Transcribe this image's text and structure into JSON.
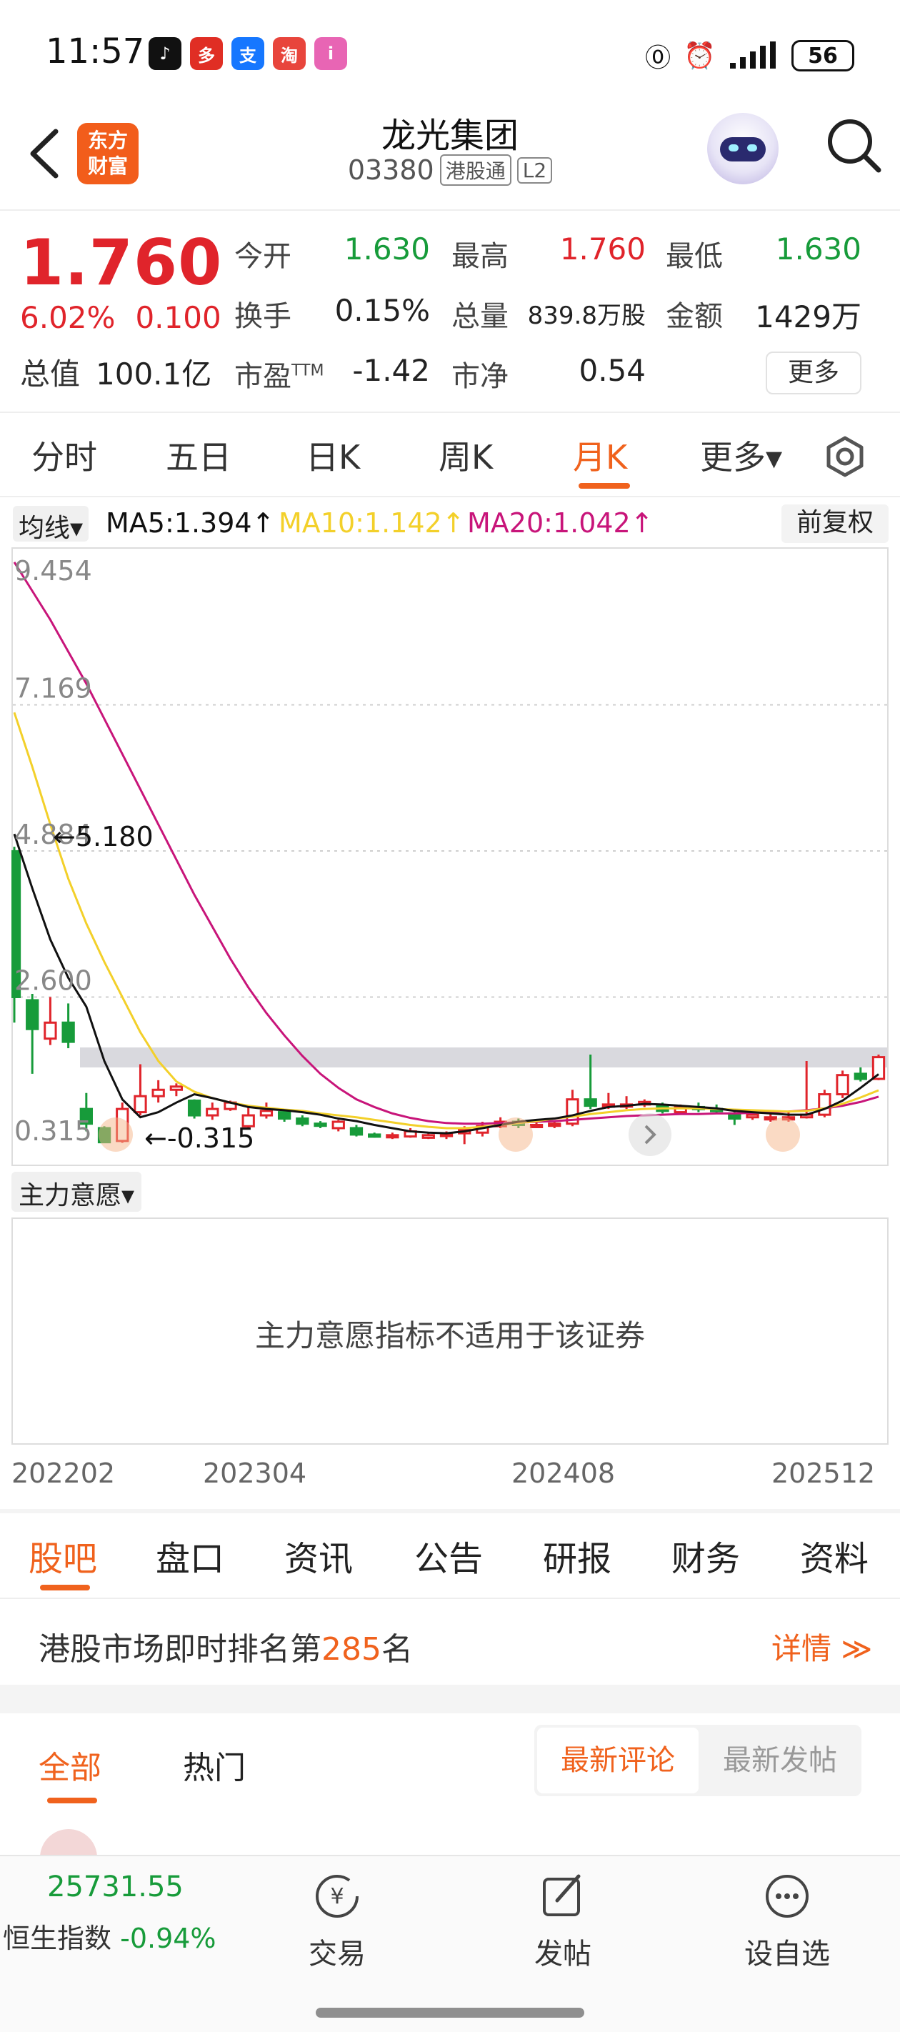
{
  "status_bar": {
    "time": "11:57",
    "battery": "56",
    "app_icons": [
      {
        "name": "douyin-icon",
        "glyph": "♪",
        "color": "#111111"
      },
      {
        "name": "pinduoduo-icon",
        "glyph": "多",
        "color": "#e02e24"
      },
      {
        "name": "alipay-icon",
        "glyph": "支",
        "color": "#1677ff"
      },
      {
        "name": "taobao-icon",
        "glyph": "淘",
        "color": "#e8453c"
      },
      {
        "name": "app-icon",
        "glyph": "i",
        "color": "#e865b4"
      }
    ]
  },
  "header": {
    "brand_line1": "东方",
    "brand_line2": "财富",
    "stock_name": "龙光集团",
    "stock_code": "03380",
    "tag_connect": "港股通",
    "tag_level": "L2"
  },
  "quote": {
    "price": "1.760",
    "change_pct": "6.02%",
    "change_abs": "0.100",
    "open_label": "今开",
    "open": "1.630",
    "high_label": "最高",
    "high": "1.760",
    "low_label": "最低",
    "low": "1.630",
    "turnover_label": "换手",
    "turnover": "0.15%",
    "volume_label": "总量",
    "volume": "839.8万股",
    "amount_label": "金额",
    "amount": "1429万",
    "mcap_label": "总值",
    "mcap": "100.1亿",
    "pe_label": "市盈",
    "pe_sup": "TTM",
    "pe": "-1.42",
    "pb_label": "市净",
    "pb": "0.54",
    "more_label": "更多"
  },
  "period_tabs": {
    "items": [
      "分时",
      "五日",
      "日K",
      "周K",
      "月K",
      "更多▾"
    ],
    "active_index": 4
  },
  "ma_row": {
    "select": "均线▾",
    "ma5": "MA5:1.394↑",
    "ma10": "MA10:1.142↑",
    "ma20": "MA20:1.042↑",
    "ma5_color": "#111111",
    "ma10_color": "#f3d02a",
    "ma20_color": "#c8157a",
    "adjust_label": "前复权"
  },
  "chart_data": {
    "type": "candlestick",
    "y_ticks": [
      "9.454",
      "7.169",
      "4.884",
      "2.600",
      "0.315"
    ],
    "ylim": [
      0.315,
      9.454
    ],
    "high_marker": "5.180",
    "low_marker": "-0.315",
    "up_color": "#e0242b",
    "down_color": "#179b3a",
    "candles": [
      {
        "o": 4.88,
        "c": 2.6,
        "h": 4.95,
        "l": 2.2
      },
      {
        "o": 2.55,
        "c": 2.1,
        "h": 2.65,
        "l": 1.4
      },
      {
        "o": 1.95,
        "c": 2.2,
        "h": 2.6,
        "l": 1.85
      },
      {
        "o": 2.2,
        "c": 1.9,
        "h": 2.5,
        "l": 1.8
      },
      {
        "o": 0.85,
        "c": 0.62,
        "h": 1.1,
        "l": 0.5
      },
      {
        "o": 0.55,
        "c": 0.33,
        "h": 0.58,
        "l": 0.315
      },
      {
        "o": 0.35,
        "c": 0.85,
        "h": 0.95,
        "l": 0.32
      },
      {
        "o": 0.8,
        "c": 1.05,
        "h": 1.55,
        "l": 0.75
      },
      {
        "o": 1.05,
        "c": 1.15,
        "h": 1.3,
        "l": 0.95
      },
      {
        "o": 1.15,
        "c": 1.2,
        "h": 1.25,
        "l": 1.05
      },
      {
        "o": 0.98,
        "c": 0.75,
        "h": 1.0,
        "l": 0.7
      },
      {
        "o": 0.75,
        "c": 0.85,
        "h": 0.95,
        "l": 0.68
      },
      {
        "o": 0.85,
        "c": 0.95,
        "h": 0.98,
        "l": 0.82
      },
      {
        "o": 0.58,
        "c": 0.75,
        "h": 0.9,
        "l": 0.55
      },
      {
        "o": 0.75,
        "c": 0.82,
        "h": 0.95,
        "l": 0.7
      },
      {
        "o": 0.8,
        "c": 0.7,
        "h": 0.85,
        "l": 0.65
      },
      {
        "o": 0.7,
        "c": 0.62,
        "h": 0.75,
        "l": 0.58
      },
      {
        "o": 0.62,
        "c": 0.6,
        "h": 0.66,
        "l": 0.55
      },
      {
        "o": 0.55,
        "c": 0.65,
        "h": 0.68,
        "l": 0.5
      },
      {
        "o": 0.55,
        "c": 0.45,
        "h": 0.6,
        "l": 0.42
      },
      {
        "o": 0.45,
        "c": 0.42,
        "h": 0.48,
        "l": 0.4
      },
      {
        "o": 0.42,
        "c": 0.44,
        "h": 0.48,
        "l": 0.38
      },
      {
        "o": 0.42,
        "c": 0.5,
        "h": 0.55,
        "l": 0.4
      },
      {
        "o": 0.4,
        "c": 0.44,
        "h": 0.48,
        "l": 0.38
      },
      {
        "o": 0.44,
        "c": 0.46,
        "h": 0.5,
        "l": 0.38
      },
      {
        "o": 0.47,
        "c": 0.52,
        "h": 0.58,
        "l": 0.3
      },
      {
        "o": 0.48,
        "c": 0.58,
        "h": 0.65,
        "l": 0.42
      },
      {
        "o": 0.58,
        "c": 0.65,
        "h": 0.72,
        "l": 0.55
      },
      {
        "o": 0.65,
        "c": 0.6,
        "h": 0.7,
        "l": 0.55
      },
      {
        "o": 0.6,
        "c": 0.6,
        "h": 0.68,
        "l": 0.55
      },
      {
        "o": 0.6,
        "c": 0.62,
        "h": 0.66,
        "l": 0.55
      },
      {
        "o": 0.62,
        "c": 1.0,
        "h": 1.15,
        "l": 0.58
      },
      {
        "o": 1.0,
        "c": 0.9,
        "h": 1.7,
        "l": 0.85
      },
      {
        "o": 0.9,
        "c": 0.92,
        "h": 1.1,
        "l": 0.85
      },
      {
        "o": 0.92,
        "c": 0.92,
        "h": 1.05,
        "l": 0.85
      },
      {
        "o": 0.92,
        "c": 0.96,
        "h": 1.0,
        "l": 0.88
      },
      {
        "o": 0.9,
        "c": 0.82,
        "h": 0.95,
        "l": 0.78
      },
      {
        "o": 0.8,
        "c": 0.88,
        "h": 0.92,
        "l": 0.78
      },
      {
        "o": 0.88,
        "c": 0.85,
        "h": 0.95,
        "l": 0.8
      },
      {
        "o": 0.85,
        "c": 0.82,
        "h": 0.92,
        "l": 0.78
      },
      {
        "o": 0.78,
        "c": 0.7,
        "h": 0.82,
        "l": 0.6
      },
      {
        "o": 0.72,
        "c": 0.76,
        "h": 0.8,
        "l": 0.68
      },
      {
        "o": 0.72,
        "c": 0.72,
        "h": 0.78,
        "l": 0.65
      },
      {
        "o": 0.72,
        "c": 0.72,
        "h": 0.8,
        "l": 0.65
      },
      {
        "o": 0.72,
        "c": 0.76,
        "h": 1.6,
        "l": 0.7
      },
      {
        "o": 0.76,
        "c": 1.08,
        "h": 1.15,
        "l": 0.72
      },
      {
        "o": 1.08,
        "c": 1.38,
        "h": 1.45,
        "l": 1.02
      },
      {
        "o": 1.4,
        "c": 1.32,
        "h": 1.5,
        "l": 1.28
      },
      {
        "o": 1.32,
        "c": 1.66,
        "h": 1.7,
        "l": 1.3
      }
    ],
    "ma5": [
      5.15,
      4.3,
      3.5,
      2.9,
      2.45,
      1.6,
      1.0,
      0.72,
      0.8,
      0.95,
      1.08,
      1.02,
      0.95,
      0.88,
      0.85,
      0.83,
      0.8,
      0.76,
      0.7,
      0.66,
      0.6,
      0.55,
      0.5,
      0.48,
      0.47,
      0.5,
      0.55,
      0.6,
      0.65,
      0.68,
      0.7,
      0.75,
      0.82,
      0.88,
      0.9,
      0.93,
      0.92,
      0.9,
      0.88,
      0.86,
      0.82,
      0.8,
      0.78,
      0.76,
      0.76,
      0.85,
      0.98,
      1.18,
      1.394
    ],
    "ma10": [
      7.05,
      6.2,
      5.3,
      4.45,
      3.75,
      3.15,
      2.6,
      2.05,
      1.6,
      1.28,
      1.12,
      1.02,
      0.95,
      0.9,
      0.87,
      0.84,
      0.82,
      0.78,
      0.75,
      0.72,
      0.68,
      0.64,
      0.6,
      0.57,
      0.55,
      0.55,
      0.57,
      0.6,
      0.63,
      0.66,
      0.7,
      0.73,
      0.77,
      0.8,
      0.83,
      0.85,
      0.86,
      0.86,
      0.86,
      0.85,
      0.84,
      0.83,
      0.82,
      0.81,
      0.82,
      0.86,
      0.93,
      1.03,
      1.142
    ],
    "ma20": [
      9.4,
      8.95,
      8.5,
      8.0,
      7.5,
      6.95,
      6.4,
      5.85,
      5.3,
      4.75,
      4.2,
      3.7,
      3.2,
      2.75,
      2.35,
      2.0,
      1.68,
      1.4,
      1.18,
      1.0,
      0.88,
      0.78,
      0.71,
      0.66,
      0.63,
      0.62,
      0.62,
      0.63,
      0.64,
      0.65,
      0.66,
      0.68,
      0.7,
      0.72,
      0.74,
      0.75,
      0.76,
      0.77,
      0.77,
      0.78,
      0.78,
      0.79,
      0.8,
      0.81,
      0.83,
      0.86,
      0.9,
      0.96,
      1.042
    ]
  },
  "indicator": {
    "select": "主力意愿▾",
    "message": "主力意愿指标不适用于该证券"
  },
  "date_labels": [
    "202202",
    "202304",
    "202408",
    "202512"
  ],
  "bottom_tabs": {
    "items": [
      "股吧",
      "盘口",
      "资讯",
      "公告",
      "研报",
      "财务",
      "资料"
    ],
    "active_index": 0
  },
  "rank": {
    "prefix": "港股市场即时排名第",
    "number": "285",
    "suffix": "名",
    "detail": "详情 ≫"
  },
  "feed_tabs": {
    "all": "全部",
    "hot": "热门",
    "latest_comment": "最新评论",
    "latest_post": "最新发帖"
  },
  "bottom_bar": {
    "index_value": "25731.55",
    "index_name": "恒生指数",
    "index_change": "-0.94%",
    "trade": "交易",
    "post": "发帖",
    "watch": "设自选"
  }
}
